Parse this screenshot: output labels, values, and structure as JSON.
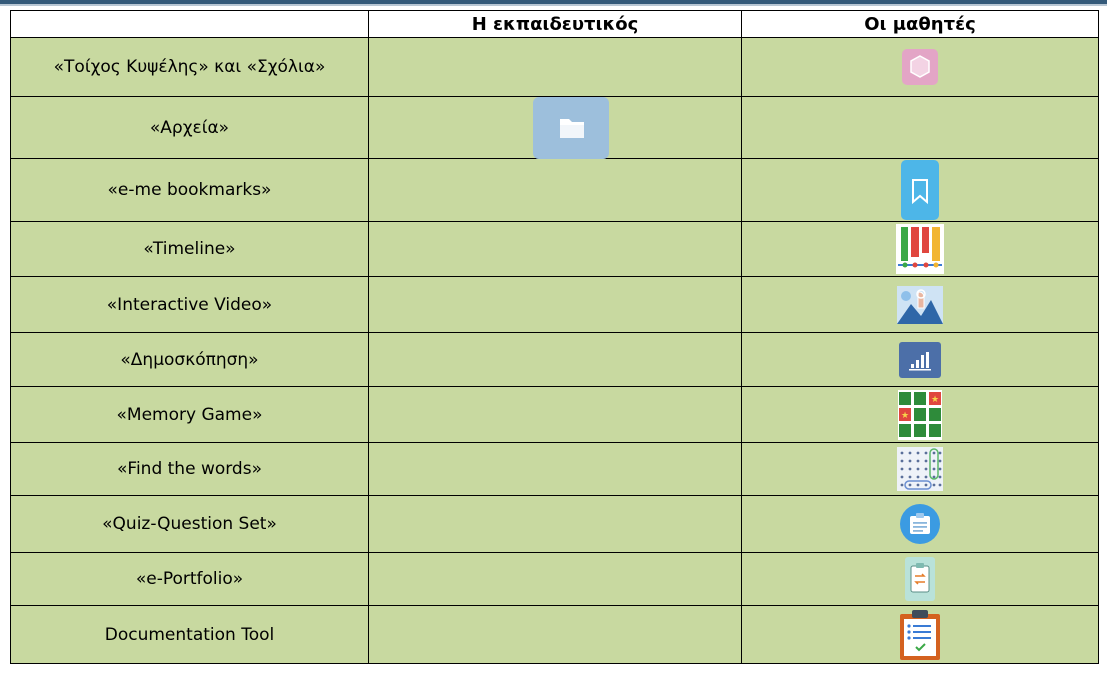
{
  "header": {
    "col_teacher": "Η εκπαιδευτικός",
    "col_students": "Οι μαθητές"
  },
  "rows": [
    {
      "label": "«Τοίχος Κυψέλης» και «Σχόλια»",
      "icon_column": "students",
      "icon": "hexagon-icon",
      "icon_color": "#e6a8c7"
    },
    {
      "label": "«Αρχεία»",
      "icon_column": "teacher",
      "icon": "folder-icon",
      "icon_color": "#96b9d8"
    },
    {
      "label": "«e-me bookmarks»",
      "icon_column": "students",
      "icon": "bookmark-icon",
      "icon_color": "#4ab4e6"
    },
    {
      "label": "«Timeline»",
      "icon_column": "students",
      "icon": "timeline-icon",
      "icon_color": "#e0504a"
    },
    {
      "label": "«Interactive Video»",
      "icon_column": "students",
      "icon": "interactive-video-icon",
      "icon_color": "#4a86c8"
    },
    {
      "label": "«Δημοσκόπηση»",
      "icon_column": "students",
      "icon": "poll-chart-icon",
      "icon_color": "#4b6ea8"
    },
    {
      "label": "«Memory Game»",
      "icon_column": "students",
      "icon": "memory-game-icon",
      "icon_color": "#2e8b3a"
    },
    {
      "label": "«Find the words»",
      "icon_column": "students",
      "icon": "word-search-icon",
      "icon_color": "#6a8ab8"
    },
    {
      "label": "«Quiz-Question Set»",
      "icon_column": "students",
      "icon": "quiz-icon",
      "icon_color": "#3a9ae0"
    },
    {
      "label": "«e-Portfolio»",
      "icon_column": "students",
      "icon": "portfolio-icon",
      "icon_color": "#b8e0d8"
    },
    {
      "label": "Documentation Tool",
      "icon_column": "students",
      "icon": "clipboard-list-icon",
      "icon_color": "#d05a1a"
    }
  ]
}
